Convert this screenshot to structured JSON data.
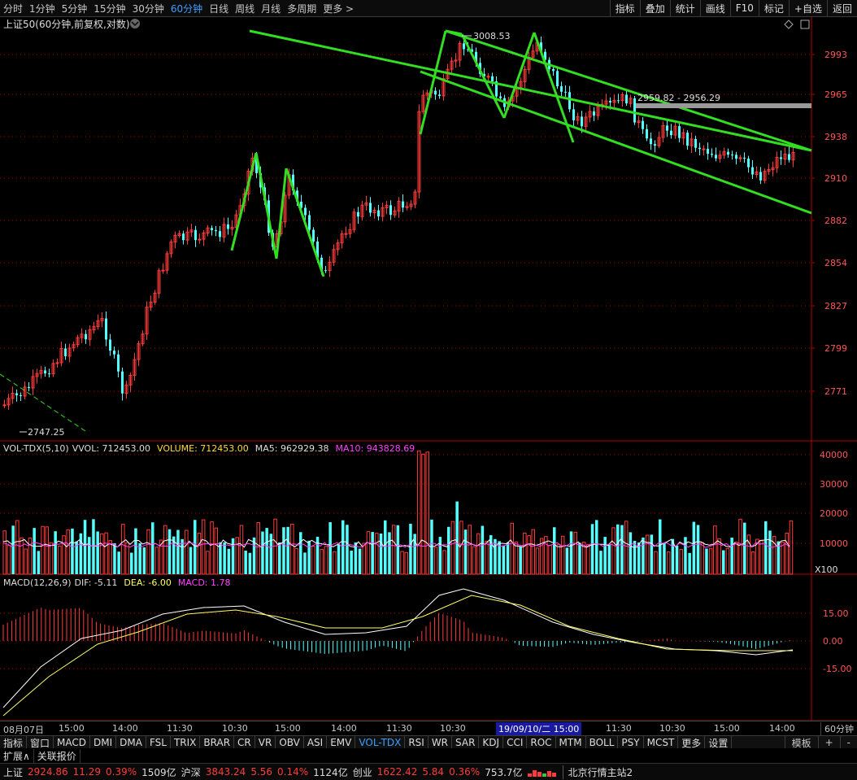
{
  "top_bar": {
    "periods": [
      "分时",
      "1分钟",
      "5分钟",
      "15分钟",
      "30分钟",
      "60分钟",
      "日线",
      "周线",
      "月线",
      "多周期",
      "更多 >"
    ],
    "active_period": "60分钟",
    "right_buttons": [
      "指标",
      "叠加",
      "统计",
      "画线",
      "F10",
      "标记",
      "+自选",
      "返回"
    ]
  },
  "main_panel": {
    "title": "上证50(60分钟,前复权,对数)",
    "y_ticks": [
      "2993",
      "2965",
      "2938",
      "2910",
      "2882",
      "2854",
      "2827",
      "2799",
      "2771"
    ],
    "high_label": "3008.53",
    "low_label": "2747.25",
    "range_label": "2959.82 - 2956.29"
  },
  "volume_panel": {
    "indicator": "VOL-TDX(5,10)",
    "vvol_label": "VVOL: 712453.00",
    "volume_label": "VOLUME: 712453.00",
    "ma5_label": "MA5: 962929.38",
    "ma10_label": "MA10: 943828.69",
    "y_ticks": [
      "40000",
      "30000",
      "20000",
      "10000"
    ],
    "unit": "X100"
  },
  "macd_panel": {
    "indicator": "MACD(12,26,9)",
    "dif_label": "DIF: -5.11",
    "dea_label": "DEA: -6.00",
    "macd_label": "MACD: 1.78",
    "y_ticks": [
      "15.00",
      "0.00",
      "-15.00"
    ]
  },
  "time_axis": {
    "labels": [
      "08月07日",
      "15:00",
      "14:00",
      "11:30",
      "10:30",
      "15:00",
      "14:00",
      "11:30",
      "10:30",
      "15:00",
      "11:30",
      "10:30",
      "15:00",
      "14:00"
    ],
    "cursor_label": "19/09/10/二 15:00",
    "period_label": "60分钟"
  },
  "indicator_bar": {
    "tabs": [
      "指标",
      "窗口",
      "MACD",
      "DMI",
      "DMA",
      "FSL",
      "TRIX",
      "BRAR",
      "CR",
      "VR",
      "OBV",
      "ASI",
      "EMV",
      "VOL-TDX",
      "RSI",
      "WR",
      "SAR",
      "KDJ",
      "CCI",
      "ROC",
      "MTM",
      "BOLL",
      "PSY",
      "MCST",
      "更多",
      "设置"
    ],
    "active_tab": "VOL-TDX",
    "right": [
      "模板",
      "+",
      "-"
    ]
  },
  "extra_bar": {
    "items": [
      "扩展∧",
      "关联报价"
    ]
  },
  "status_bar": {
    "sh_name": "上证",
    "sh_price": "2924.86",
    "sh_change": "11.29",
    "sh_pct": "0.39%",
    "sh_amount": "1509亿",
    "sz_name": "沪深",
    "sz_price": "3843.24",
    "sz_change": "5.56",
    "sz_pct": "0.14%",
    "sz_amount": "1124亿",
    "cy_name": "创业",
    "cy_price": "1622.42",
    "cy_change": "5.84",
    "cy_pct": "0.36%",
    "cy_amount": "753.7亿",
    "station": "北京行情主站2"
  },
  "colors": {
    "up": "#ff3b3b",
    "down": "#54ffff",
    "trend": "#33dd22",
    "ma5": "#ffffff",
    "ma10": "#ff40ff",
    "dea": "#ffff66",
    "axis": "#b00000"
  }
}
